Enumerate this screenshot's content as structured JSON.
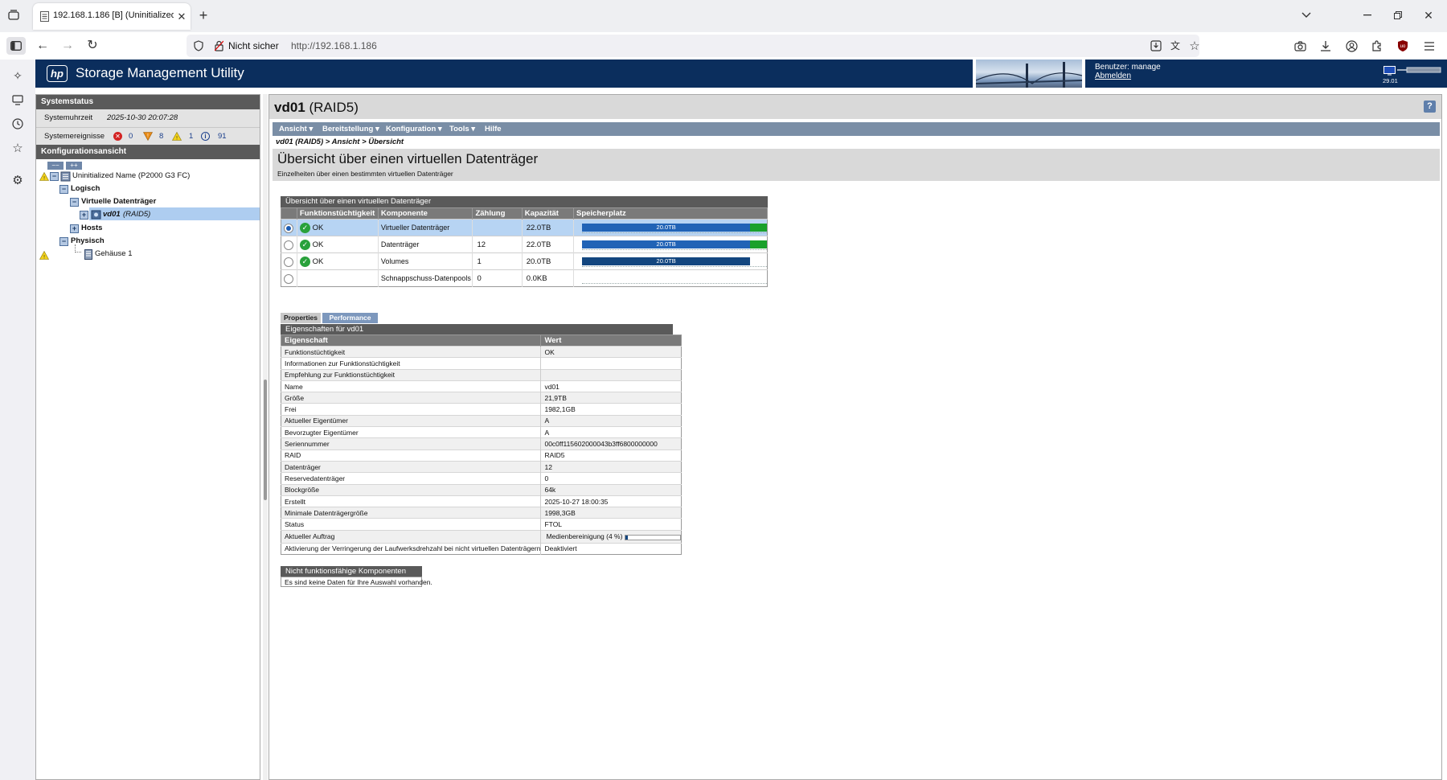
{
  "browser": {
    "tab_title": "192.168.1.186 [B] (Uninitialized",
    "not_secure_label": "Nicht sicher",
    "url": "http://192.168.1.186"
  },
  "app": {
    "title": "Storage Management Utility",
    "logo_text": "hp",
    "user_label": "Benutzer: manage",
    "logout_label": "Abmelden",
    "version": "29.01"
  },
  "left": {
    "system_status_title": "Systemstatus",
    "system_time_label": "Systemuhrzeit",
    "system_time_value": "2025-10-30 20:07:28",
    "events_label": "Systemereignisse",
    "events": {
      "critical": "0",
      "error": "8",
      "warning": "1",
      "info": "91"
    },
    "config_view_title": "Konfigurationsansicht",
    "collapse_btn": "−−",
    "expand_btn": "++",
    "tree": {
      "root": "Uninitialized Name (P2000 G3 FC)",
      "logical": "Logisch",
      "vdisks": "Virtuelle Datenträger",
      "vd_name": "vd01",
      "vd_raid": "(RAID5)",
      "hosts": "Hosts",
      "physical": "Physisch",
      "enclosure": "Gehäuse 1"
    }
  },
  "main": {
    "title_name": "vd01",
    "title_raid": "(RAID5)",
    "help_btn": "?",
    "menu": [
      "Ansicht",
      "Bereitstellung",
      "Konfiguration",
      "Tools",
      "Hilfe"
    ],
    "breadcrumb": "vd01 (RAID5) > Ansicht > Übersicht",
    "heading": "Übersicht über einen virtuellen Datenträger",
    "subheading": "Einzelheiten über einen bestimmten virtuellen Datenträger",
    "overview": {
      "title": "Übersicht über einen virtuellen Datenträger",
      "headers": [
        "Funktionstüchtigkeit",
        "Komponente",
        "Zählung",
        "Kapazität",
        "Speicherplatz"
      ],
      "rows": [
        {
          "health": "OK",
          "component": "Virtueller Datenträger",
          "count": "",
          "capacity": "22.0TB",
          "bar_label": "20.0TB",
          "used_fraction": 0.91,
          "free_fraction": 0.09,
          "selected": true
        },
        {
          "health": "OK",
          "component": "Datenträger",
          "count": "12",
          "capacity": "22.0TB",
          "bar_label": "20.0TB",
          "used_fraction": 0.91,
          "free_fraction": 0.09,
          "selected": false
        },
        {
          "health": "OK",
          "component": "Volumes",
          "count": "1",
          "capacity": "20.0TB",
          "bar_label": "20.0TB",
          "used_fraction": 0.91,
          "free_fraction": 0,
          "selected": false
        },
        {
          "health": "",
          "component": "Schnappschuss-Datenpools",
          "count": "0",
          "capacity": "0.0KB",
          "bar_label": "",
          "used_fraction": 0,
          "free_fraction": 0,
          "selected": false
        }
      ]
    },
    "tabs": [
      "Properties",
      "Performance"
    ],
    "properties": {
      "title": "Eigenschaften für vd01",
      "headers": [
        "Eigenschaft",
        "Wert"
      ],
      "rows": [
        [
          "Funktionstüchtigkeit",
          "OK"
        ],
        [
          "Informationen zur Funktionstüchtigkeit",
          ""
        ],
        [
          "Empfehlung zur Funktionstüchtigkeit",
          ""
        ],
        [
          "Name",
          "vd01"
        ],
        [
          "Größe",
          "21,9TB"
        ],
        [
          "Frei",
          "1982,1GB"
        ],
        [
          "Aktueller Eigentümer",
          "A"
        ],
        [
          "Bevorzugter Eigentümer",
          "A"
        ],
        [
          "Seriennummer",
          "00c0ff115602000043b3ff6800000000"
        ],
        [
          "RAID",
          "RAID5"
        ],
        [
          "Datenträger",
          "12"
        ],
        [
          "Reservedatenträger",
          "0"
        ],
        [
          "Blockgröße",
          "64k"
        ],
        [
          "Erstellt",
          "2025-10-27 18:00:35"
        ],
        [
          "Minimale Datenträgergröße",
          "1998,3GB"
        ],
        [
          "Status",
          "FTOL"
        ],
        [
          "Aktueller Auftrag",
          "Medienbereinigung (4 %)"
        ],
        [
          "Aktivierung der Verringerung der Laufwerksdrehzahl bei nicht virtuellen Datenträgern",
          "Deaktiviert"
        ]
      ],
      "job_progress": 0.04
    },
    "failed": {
      "title": "Nicht funktionsfähige Komponenten",
      "message": "Es sind keine Daten für Ihre Auswahl vorhanden."
    }
  }
}
